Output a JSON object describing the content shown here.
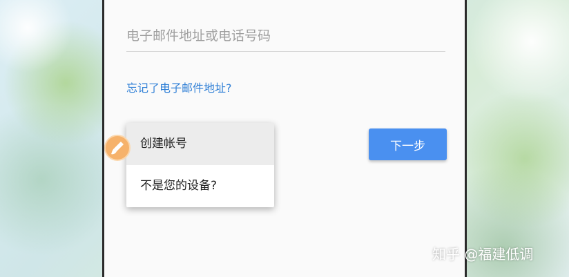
{
  "login": {
    "identifier_placeholder": "电子邮件地址或电话号码",
    "identifier_value": "",
    "forgot_email_link": "忘记了电子邮件地址?",
    "next_button": "下一步"
  },
  "options_menu": {
    "items": [
      {
        "label": "创建帐号"
      },
      {
        "label": "不是您的设备?"
      }
    ]
  },
  "overlay": {
    "badge_icon": "paintbrush-icon",
    "watermark_text": "知乎 @福建低调"
  },
  "colors": {
    "accent": "#4a90f0",
    "link": "#2f7fd6",
    "badge": "#f6b26b"
  }
}
